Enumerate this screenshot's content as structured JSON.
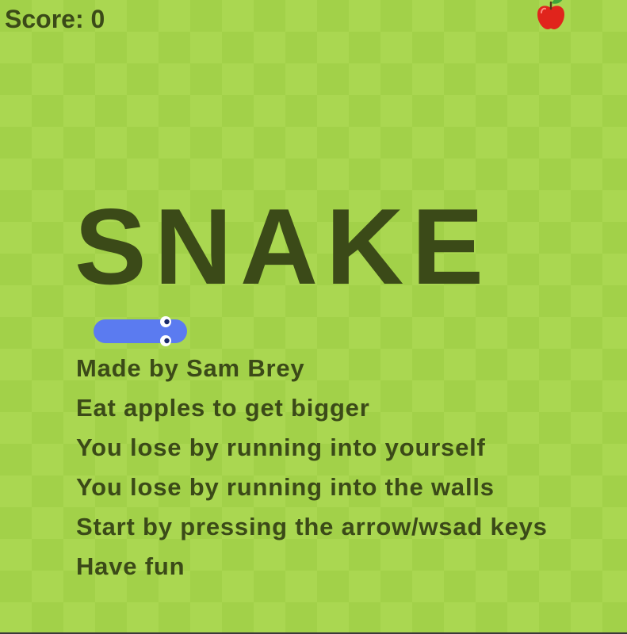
{
  "score": {
    "label": "Score: 0"
  },
  "apple": {
    "icon": "apple-icon",
    "color": "#e0241c"
  },
  "title": "SNAKE",
  "snake": {
    "color": "#5b7bf0"
  },
  "instructions": [
    "Made by Sam Brey",
    "Eat apples to get bigger",
    "You lose by running into yourself",
    "You lose by running into the walls",
    "Start by pressing the arrow/wsad keys",
    "Have fun"
  ],
  "board": {
    "light": "#aad751",
    "dark": "#a2d149",
    "text": "#3b4a18"
  }
}
